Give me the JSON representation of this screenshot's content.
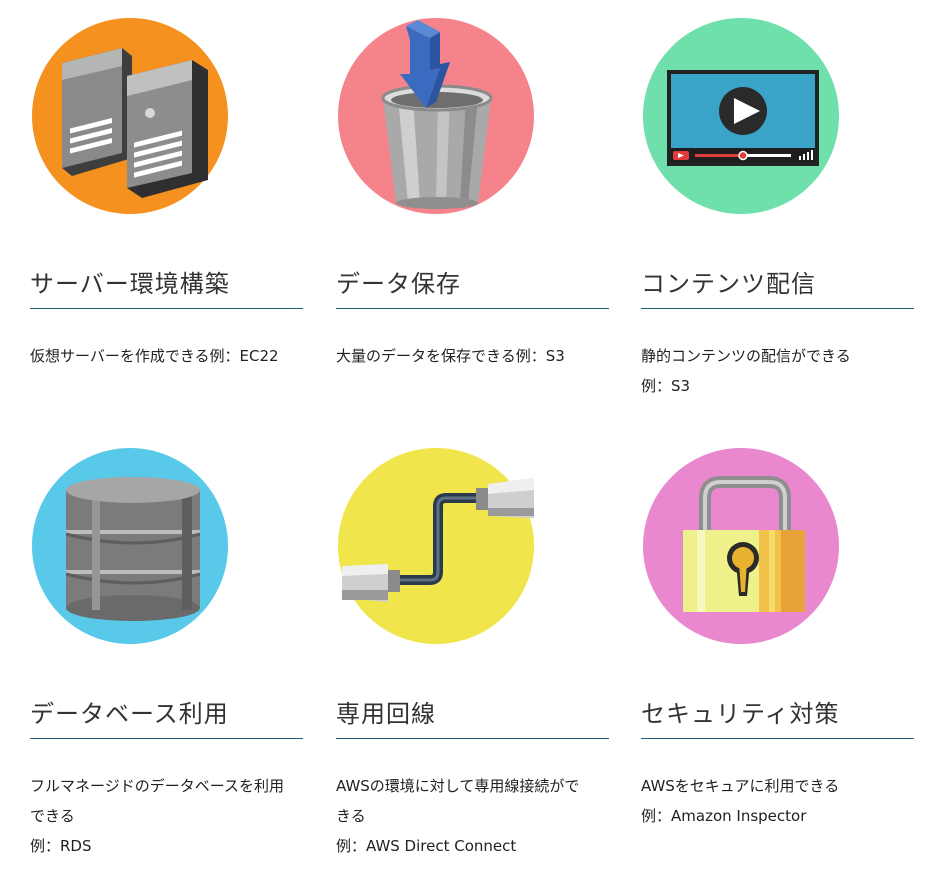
{
  "features": [
    {
      "title": "サーバー環境構築",
      "description": [
        "仮想サーバーを作成できる例：EC22"
      ],
      "icon": "server-icon",
      "color": "#f5911e"
    },
    {
      "title": "データ保存",
      "description": [
        "大量のデータを保存できる例：S3"
      ],
      "icon": "bucket-icon",
      "color": "#f4838c"
    },
    {
      "title": "コンテンツ配信",
      "description": [
        "静的コンテンツの配信ができる",
        "例：S3"
      ],
      "icon": "video-player-icon",
      "color": "#6fdfac"
    },
    {
      "title": "データベース利用",
      "description": [
        "フルマネージドのデータベースを利用",
        "できる",
        "例：RDS"
      ],
      "icon": "database-icon",
      "color": "#59c9ea"
    },
    {
      "title": "専用回線",
      "description": [
        "AWSの環境に対して専用線接続がで",
        "きる",
        "例：AWS Direct Connect"
      ],
      "icon": "cable-icon",
      "color": "#f0e54a"
    },
    {
      "title": "セキュリティ対策",
      "description": [
        "AWSをセキュアに利用できる",
        "例：Amazon Inspector"
      ],
      "icon": "padlock-icon",
      "color": "#e987cf"
    }
  ]
}
